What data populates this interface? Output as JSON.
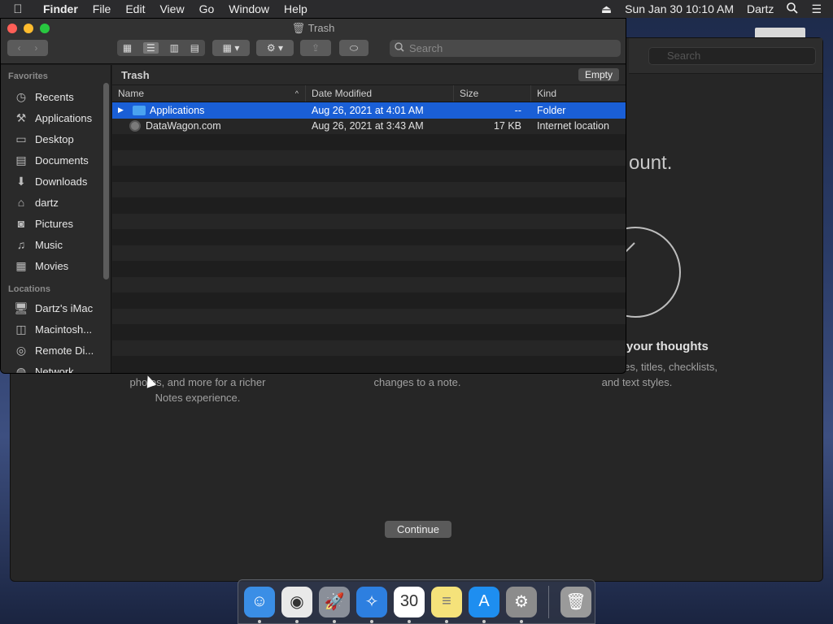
{
  "menubar": {
    "apple": "",
    "app": "Finder",
    "items": [
      "File",
      "Edit",
      "View",
      "Go",
      "Window",
      "Help"
    ],
    "clock": "Sun Jan 30  10:10 AM",
    "user": "Dartz"
  },
  "notes": {
    "search_placeholder": "Search",
    "heading": "ount.",
    "feature_title": "your thoughts",
    "feature_text_right": "notes with tables, titles, checklists, and text styles.",
    "feature_text_left": "photos, and more for a richer Notes experience.",
    "feature_text_mid": "changes to a note.",
    "continue": "Continue"
  },
  "finder": {
    "title": "Trash",
    "search_placeholder": "Search",
    "path": "Trash",
    "empty_button": "Empty",
    "columns": {
      "name": "Name",
      "date": "Date Modified",
      "size": "Size",
      "kind": "Kind"
    },
    "files": [
      {
        "name": "Applications",
        "date": "Aug 26, 2021 at 4:01 AM",
        "size": "--",
        "kind": "Folder"
      },
      {
        "name": "DataWagon.com",
        "date": "Aug 26, 2021 at 3:43 AM",
        "size": "17 KB",
        "kind": "Internet location"
      }
    ]
  },
  "sidebar": {
    "favorites_heading": "Favorites",
    "favorites": [
      {
        "label": "Recents",
        "icon": "clock-icon"
      },
      {
        "label": "Applications",
        "icon": "applications-icon"
      },
      {
        "label": "Desktop",
        "icon": "desktop-icon"
      },
      {
        "label": "Documents",
        "icon": "documents-icon"
      },
      {
        "label": "Downloads",
        "icon": "downloads-icon"
      },
      {
        "label": "dartz",
        "icon": "home-icon"
      },
      {
        "label": "Pictures",
        "icon": "pictures-icon"
      },
      {
        "label": "Music",
        "icon": "music-icon"
      },
      {
        "label": "Movies",
        "icon": "movies-icon"
      }
    ],
    "locations_heading": "Locations",
    "locations": [
      {
        "label": "Dartz's iMac",
        "icon": "imac-icon"
      },
      {
        "label": "Macintosh...",
        "icon": "disk-icon"
      },
      {
        "label": "Remote Di...",
        "icon": "remote-disc-icon"
      },
      {
        "label": "Network",
        "icon": "network-icon"
      }
    ]
  },
  "dock": {
    "apps": [
      {
        "name": "finder",
        "color": "#3a8ee6",
        "glyph": "☺"
      },
      {
        "name": "chrome",
        "color": "#e9e9e9",
        "glyph": "◉"
      },
      {
        "name": "launchpad",
        "color": "#8a8f99",
        "glyph": "🚀"
      },
      {
        "name": "safari",
        "color": "#2d7fe0",
        "glyph": "✧"
      },
      {
        "name": "calendar",
        "color": "#ffffff",
        "glyph": "30"
      },
      {
        "name": "notes",
        "color": "#f5e27a",
        "glyph": "≡"
      },
      {
        "name": "app-store",
        "color": "#1e8ef0",
        "glyph": "A"
      },
      {
        "name": "system-preferences",
        "color": "#8c8c8c",
        "glyph": "⚙"
      },
      {
        "name": "trash",
        "color": "#9a9a9a",
        "glyph": "🗑"
      }
    ]
  }
}
